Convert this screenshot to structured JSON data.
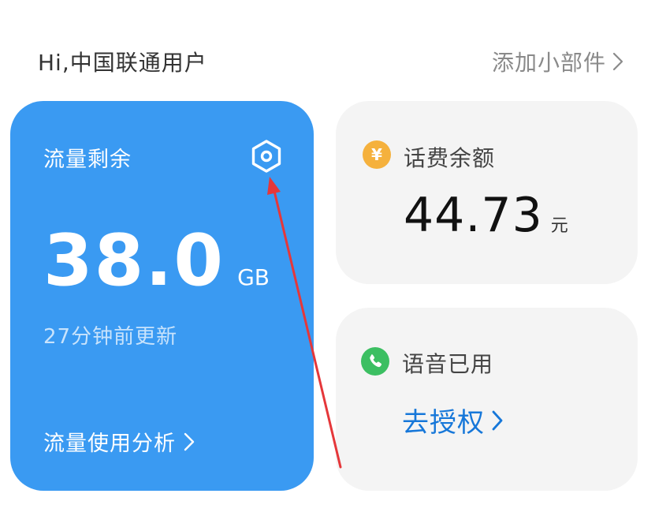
{
  "header": {
    "greeting": "Hi,中国联通用户",
    "add_widget_label": "添加小部件"
  },
  "data_card": {
    "title": "流量剩余",
    "remaining_value": "38.0",
    "remaining_unit": "GB",
    "updated_text": "27分钟前更新",
    "analysis_link": "流量使用分析"
  },
  "bill_card": {
    "label": "话费余额",
    "balance_value": "44.73",
    "balance_unit": "元",
    "icon_symbol": "¥"
  },
  "voice_card": {
    "label": "语音已用",
    "authorize_link": "去授权"
  },
  "colors": {
    "data_card_bg": "#3a9af2",
    "card_bg": "#f4f4f4",
    "yen_icon": "#f5b13d",
    "phone_icon": "#3cbf62",
    "link_blue": "#1677d9",
    "annotation_arrow": "#e5373a"
  }
}
